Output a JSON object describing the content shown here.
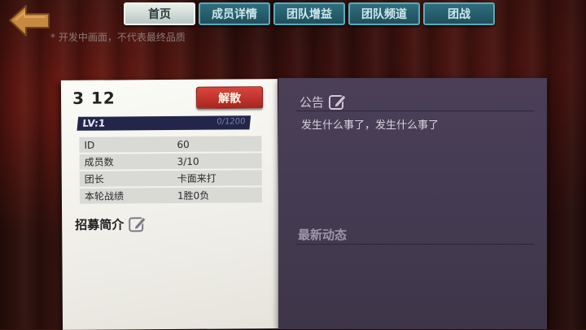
{
  "notice": "* 开发中画面，不代表最终品质",
  "tabs": [
    {
      "label": "首页",
      "active": true
    },
    {
      "label": "成员详情",
      "active": false
    },
    {
      "label": "团队增益",
      "active": false
    },
    {
      "label": "团队频道",
      "active": false
    },
    {
      "label": "团战",
      "active": false
    }
  ],
  "team": {
    "number": "3 12",
    "disband_label": "解散",
    "level_label": "LV:1",
    "exp_text": "0/1200",
    "exp_fraction": 0,
    "info": [
      {
        "key": "ID",
        "value": "60"
      },
      {
        "key": "成员数",
        "value": "3/10"
      },
      {
        "key": "团长",
        "value": "卡面来打"
      },
      {
        "key": "本轮战绩",
        "value": "1胜0负"
      }
    ],
    "recruit_label": "招募简介"
  },
  "panel": {
    "announce_title": "公告",
    "announce_text": "发生什么事了，发生什么事了",
    "news_title": "最新动态"
  },
  "icons": {
    "back": "back-arrow-icon",
    "edit": "edit-pencil-icon"
  },
  "colors": {
    "tab_active": "#e9efe9",
    "tab": "#2f6e7e",
    "disband": "#c4362d",
    "panel": "#463c52",
    "level_bar": "#23264a"
  }
}
